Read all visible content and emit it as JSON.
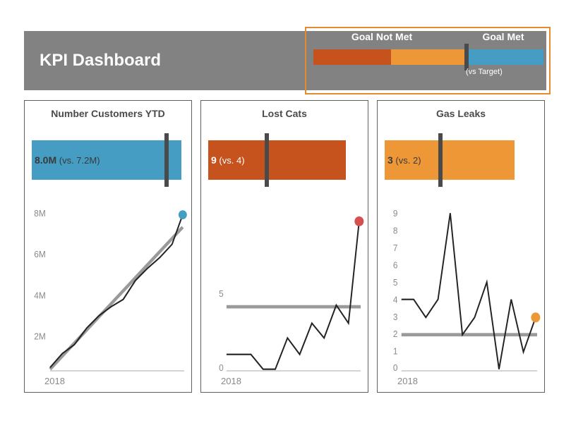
{
  "header": {
    "title": "KPI Dashboard"
  },
  "legend": {
    "notmet_label": "Goal Not Met",
    "met_label": "Goal Met",
    "sub_label": "(vs Target)"
  },
  "cards": [
    {
      "title": "Number Customers YTD",
      "bullet": {
        "value_text": "8.0M",
        "vs_text": " (vs. 7.2M)",
        "color": "blue",
        "width_frac": 0.94,
        "marker_frac": 0.86,
        "label_light": false
      },
      "year": "2018"
    },
    {
      "title": "Lost Cats",
      "bullet": {
        "value_text": "9",
        "vs_text": " (vs. 4)",
        "color": "dorange",
        "width_frac": 0.86,
        "marker_frac": 0.4,
        "label_light": true
      },
      "year": "2018"
    },
    {
      "title": "Gas Leaks",
      "bullet": {
        "value_text": "3",
        "vs_text": " (vs. 2)",
        "color": "lorange",
        "width_frac": 0.8,
        "marker_frac": 0.38,
        "label_light": false
      },
      "year": "2018"
    }
  ],
  "chart_data": [
    {
      "type": "line",
      "title": "Number Customers YTD",
      "xlabel": "2018",
      "ylabel": "",
      "ylim": [
        0,
        8000000
      ],
      "y_ticks": [
        "2M",
        "4M",
        "6M",
        "8M"
      ],
      "series": [
        {
          "name": "actual",
          "x": [
            0,
            1,
            2,
            3,
            4,
            5,
            6,
            7,
            8,
            9,
            10,
            11
          ],
          "values": [
            200000,
            1000000,
            1500000,
            2500000,
            3200000,
            3700000,
            4100000,
            5300000,
            6000000,
            6700000,
            7300000,
            8000000
          ]
        },
        {
          "name": "target_cum",
          "x": [
            0,
            11
          ],
          "values": [
            100000,
            7200000
          ]
        }
      ],
      "annotations": {
        "last_point_color": "#459dc3"
      }
    },
    {
      "type": "line",
      "title": "Lost Cats",
      "xlabel": "2018",
      "ylabel": "",
      "ylim": [
        0,
        10
      ],
      "y_ticks": [
        "0",
        "5"
      ],
      "series": [
        {
          "name": "actual",
          "x": [
            0,
            1,
            2,
            3,
            4,
            5,
            6,
            7,
            8,
            9,
            10,
            11
          ],
          "values": [
            1,
            1,
            1,
            0,
            0,
            2,
            1,
            3,
            2,
            4,
            3,
            9
          ]
        },
        {
          "name": "target",
          "x": [
            0,
            11
          ],
          "values": [
            4,
            4
          ]
        }
      ],
      "annotations": {
        "last_point_color": "#d65050"
      }
    },
    {
      "type": "line",
      "title": "Gas Leaks",
      "xlabel": "2018",
      "ylabel": "",
      "ylim": [
        0,
        9
      ],
      "y_ticks": [
        "0",
        "1",
        "2",
        "3",
        "4",
        "5",
        "6",
        "7",
        "8",
        "9"
      ],
      "series": [
        {
          "name": "actual",
          "x": [
            0,
            1,
            2,
            3,
            4,
            5,
            6,
            7,
            8,
            9,
            10,
            11
          ],
          "values": [
            4,
            4,
            3,
            4,
            9,
            2,
            3,
            5,
            0,
            4,
            1,
            3
          ]
        },
        {
          "name": "target",
          "x": [
            0,
            11
          ],
          "values": [
            2,
            2
          ]
        }
      ],
      "annotations": {
        "last_point_color": "#ee9736"
      }
    }
  ]
}
